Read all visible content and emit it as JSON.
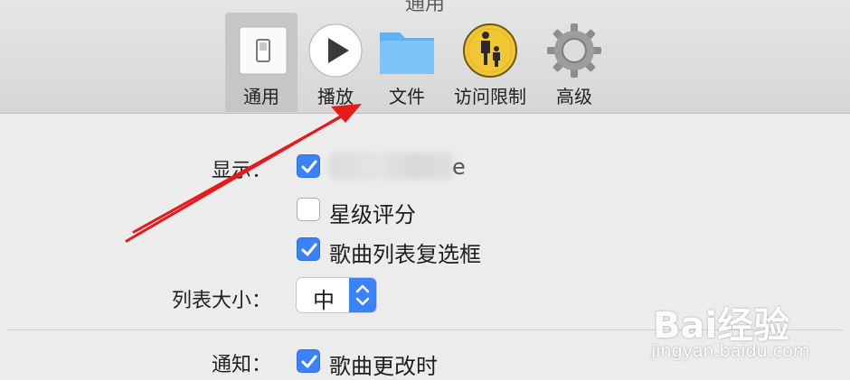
{
  "window": {
    "title": "通用"
  },
  "tabs": [
    {
      "label": "通用",
      "icon": "switch-icon"
    },
    {
      "label": "播放",
      "icon": "play-icon"
    },
    {
      "label": "文件",
      "icon": "folder-icon"
    },
    {
      "label": "访问限制",
      "icon": "parental-controls-icon"
    },
    {
      "label": "高级",
      "icon": "gear-icon"
    }
  ],
  "selected_tab": "通用",
  "settings": {
    "show_label": "显示：",
    "show_options": [
      {
        "label": "",
        "checked": true,
        "note": "obscured"
      },
      {
        "label": "星级评分",
        "checked": false
      },
      {
        "label": "歌曲列表复选框",
        "checked": true
      }
    ],
    "list_size_label": "列表大小：",
    "list_size_value": "中",
    "notify_label": "通知：",
    "notify_options": [
      {
        "label": "歌曲更改时",
        "checked": true
      }
    ]
  },
  "watermark": {
    "brand": "Bai经验",
    "url": "jingyan.baidu.com"
  },
  "colors": {
    "accent": "#3a82f7",
    "annotation_arrow": "#e8191b"
  }
}
